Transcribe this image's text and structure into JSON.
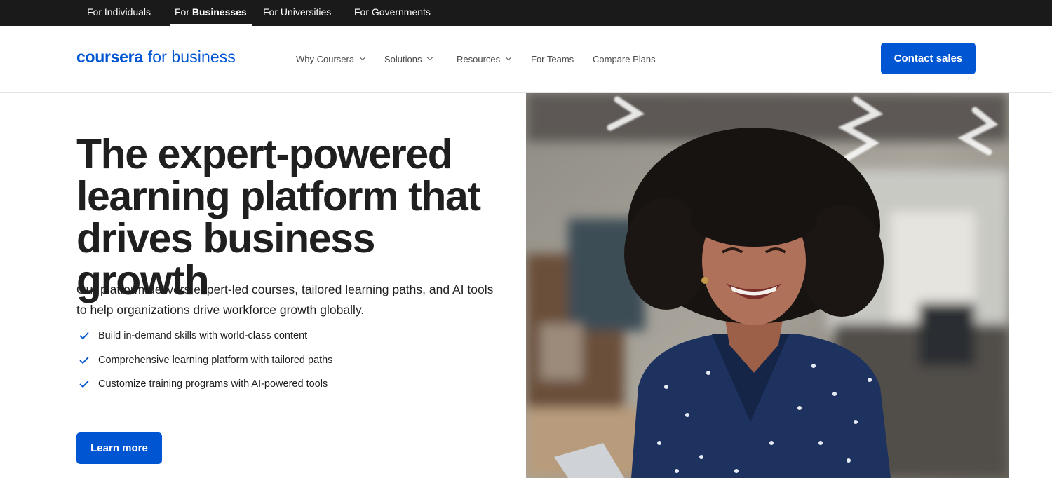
{
  "audience_nav": {
    "items": [
      {
        "label": "For Individuals",
        "active": false
      },
      {
        "label_prefix": "For ",
        "label_bold": "Businesses",
        "active": true
      },
      {
        "label": "For Universities",
        "active": false
      },
      {
        "label": "For Governments",
        "active": false
      }
    ]
  },
  "header": {
    "logo_word": "coursera",
    "logo_sub": "for business",
    "nav": [
      {
        "label": "Why Coursera",
        "dropdown": true
      },
      {
        "label": "Solutions",
        "dropdown": true
      },
      {
        "label": "Resources",
        "dropdown": true
      },
      {
        "label": "For Teams",
        "dropdown": false
      },
      {
        "label": "Compare Plans",
        "dropdown": false
      }
    ],
    "cta_label": "Contact sales"
  },
  "hero": {
    "title_lines": [
      "The expert-powered",
      "learning platform that",
      "drives business growth"
    ],
    "subtitle": "Our platform delivers expert-led courses, tailored learning paths, and AI tools to help organizations drive workforce growth globally.",
    "benefits": [
      "Build in-demand skills with world-class content",
      "Comprehensive learning platform with tailored paths",
      "Customize training programs with AI-powered tools"
    ],
    "cta_label": "Learn more",
    "image_icon": "smiling-woman-office-photo"
  },
  "colors": {
    "brand_blue": "#0056d2",
    "topbar_bg": "#1a1a1a",
    "text_dark": "#1f1f1f",
    "nav_text": "#4a4a4a"
  }
}
